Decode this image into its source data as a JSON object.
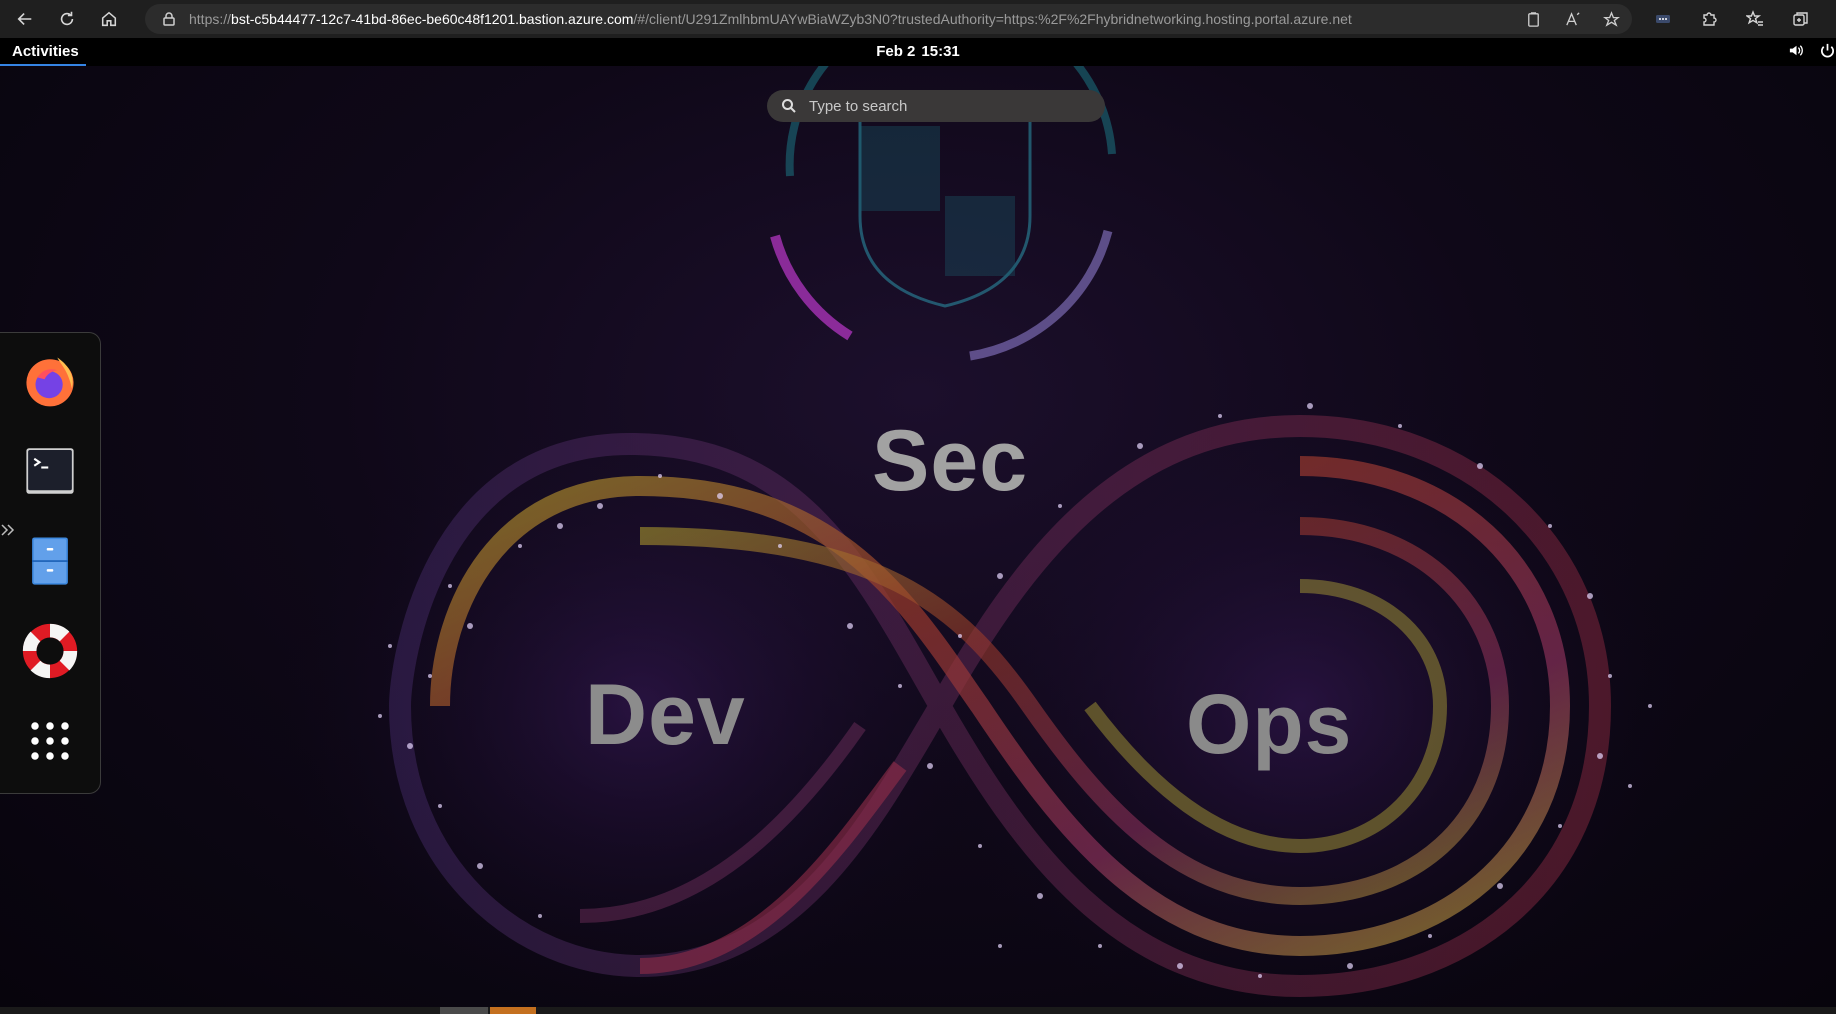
{
  "browser": {
    "url_prefix": "https://",
    "url_host": "bst-c5b44477-12c7-41bd-86ec-be60c48f1201.bastion.azure.com",
    "url_path": "/#/client/U291ZmlhbmUAYwBiaWZyb3N0?trustedAuthority=https:%2F%2Fhybridnetworking.hosting.portal.azure.net",
    "nav": [
      "back-icon",
      "refresh-icon",
      "home-icon"
    ]
  },
  "gnome": {
    "activities": "Activities",
    "date": "Feb 2",
    "time": "15:31"
  },
  "overview": {
    "search_placeholder": "Type to search"
  },
  "wallpaper": {
    "words": {
      "sec": "Sec",
      "dev": "Dev",
      "ops": "Ops"
    }
  },
  "dock": {
    "items": [
      "firefox",
      "terminal",
      "files",
      "help",
      "show-applications"
    ]
  },
  "colors": {
    "accent": "#3584e4",
    "dock_bg": "#0d0d0d",
    "search_bg": "#3a3838"
  }
}
